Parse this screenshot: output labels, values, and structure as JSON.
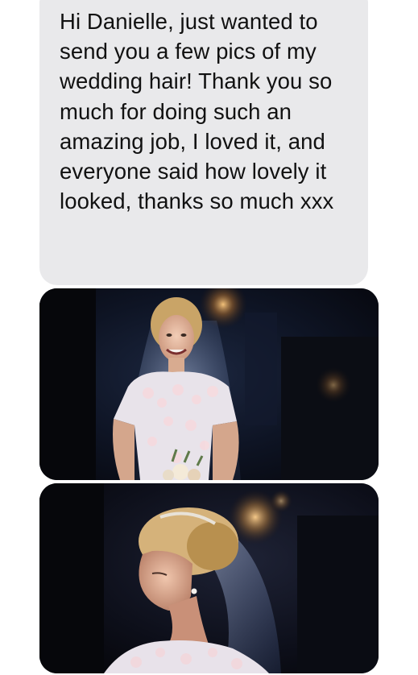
{
  "conversation": {
    "message": {
      "text": "Hi Danielle, just wanted to send you a few pics of my wedding hair! Thank you so much for doing such an amazing job, I loved it, and everyone said how lovely it looked, thanks so much xxx"
    },
    "photos": [
      {
        "icon": "bride-front-photo"
      },
      {
        "icon": "bride-side-profile-photo"
      }
    ]
  },
  "colors": {
    "bubble_background": "#e9e9eb",
    "text": "#111111",
    "background": "#ffffff"
  }
}
